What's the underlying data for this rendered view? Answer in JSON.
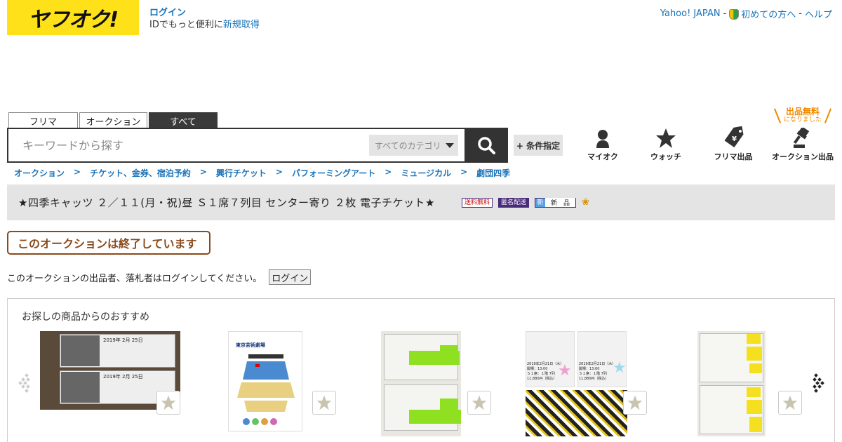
{
  "header": {
    "logo_text": "ヤフオク!",
    "login_link": "ログイン",
    "login_sub_prefix": "IDでもっと便利に",
    "signup_link": "新規取得",
    "top_links": [
      "Yahoo! JAPAN",
      "初めての方へ",
      "ヘルプ"
    ],
    "sep": "-"
  },
  "tabs": [
    {
      "label": "フリマ",
      "active": false
    },
    {
      "label": "オークション",
      "active": false
    },
    {
      "label": "すべて",
      "active": true
    }
  ],
  "search": {
    "placeholder": "キーワードから探す",
    "category": "すべてのカテゴリ",
    "condition_button": "+ 条件指定"
  },
  "quick_links": [
    {
      "label": "マイオク",
      "icon": "person-icon"
    },
    {
      "label": "ウォッチ",
      "icon": "star-icon"
    },
    {
      "label": "フリマ出品",
      "icon": "price-tag-icon"
    },
    {
      "label": "オークション出品",
      "icon": "gavel-icon"
    }
  ],
  "free_banner": {
    "line1": "出品無料",
    "line2": "になりました"
  },
  "breadcrumb": [
    "オークション",
    "チケット、金券、宿泊予約",
    "興行チケット",
    "パフォーミングアート",
    "ミュージカル",
    "劇団四季"
  ],
  "breadcrumb_sep": ">",
  "item": {
    "title": "★四季キャッツ ２／１１(月・祝)昼 Ｓ１席７列目 センター寄り ２枚 電子チケット★",
    "badges": {
      "free_shipping": "送料無料",
      "anonymous": "匿名配送",
      "new_icon": "新",
      "new_label": "新　品"
    }
  },
  "ended_message": "このオークションは終了しています",
  "login_prompt": "このオークションの出品者、落札者はログインしてください。",
  "login_button": "ログイン",
  "recommendations": {
    "title": "お探しの商品からのおすすめ",
    "thumb_texts": {
      "t1_date": "2019年 2月 25日",
      "t2_venue": "東京芸術劇場",
      "t4_line1": "2019年2月21日（木）",
      "t4_line2": "開場：13:00",
      "t4_line3": "Ｓ１席：１階 7列",
      "t4_line4": "11,880円（税込）"
    }
  },
  "colors": {
    "logo_bg": "#ffe11a",
    "link": "#1a73b8",
    "ended": "#8a4a1a",
    "free_banner": "#f08a00"
  }
}
